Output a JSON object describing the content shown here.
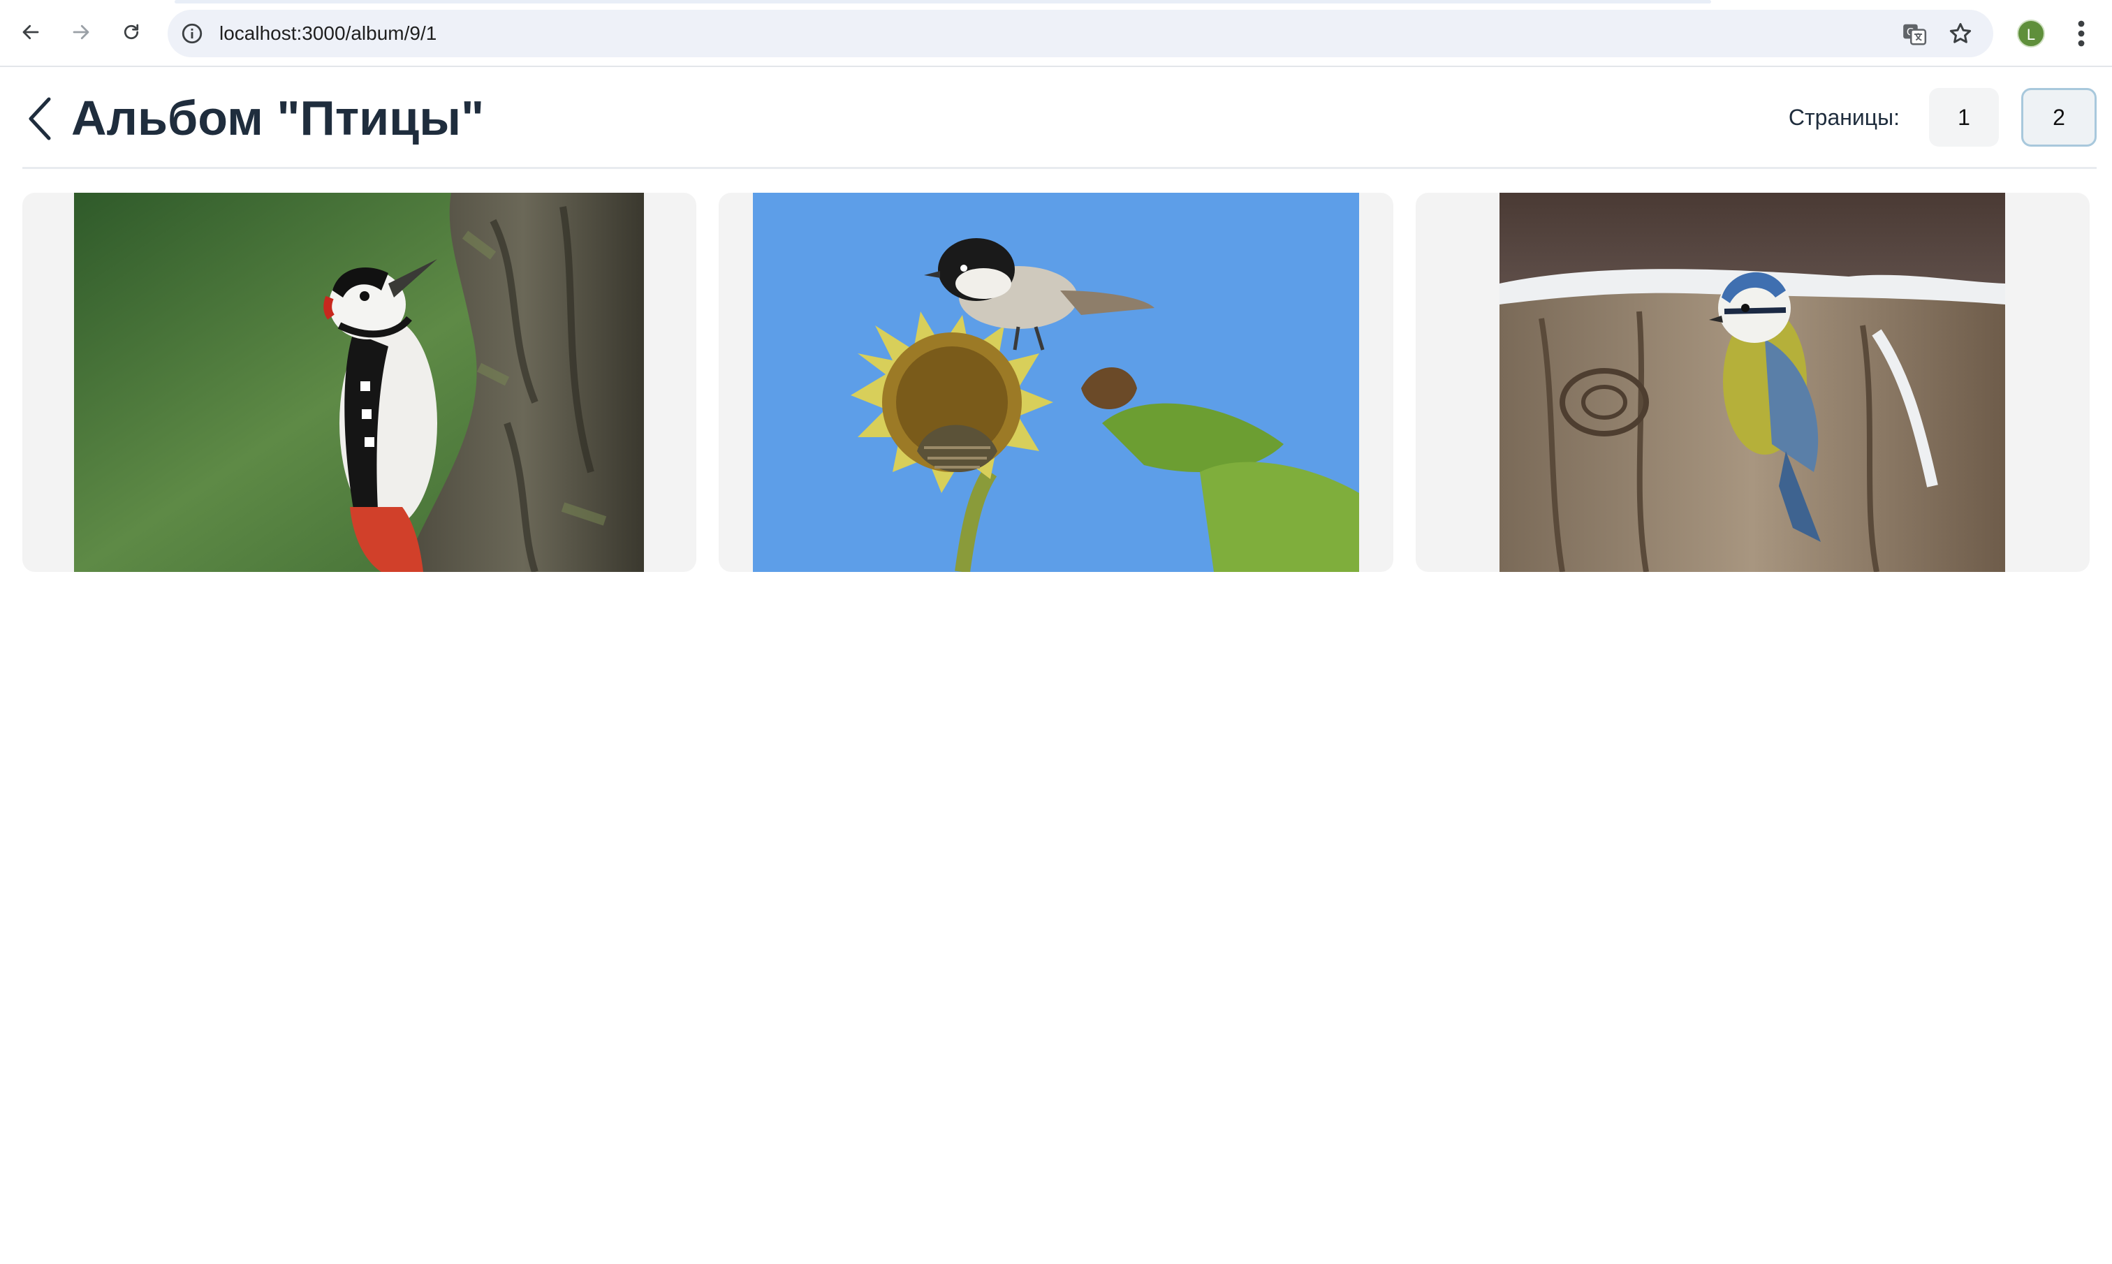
{
  "browser": {
    "url": "localhost:3000/album/9/1",
    "profile_initial": "L"
  },
  "header": {
    "title": "Альбом \"Птицы\"",
    "pages_label": "Страницы:",
    "pages": [
      "1",
      "2"
    ],
    "current_page": "2"
  },
  "gallery": {
    "photos": [
      {
        "subject": "woodpecker-on-tree-trunk"
      },
      {
        "subject": "tit-on-sunflower"
      },
      {
        "subject": "blue-tit-on-snowy-stump"
      }
    ]
  },
  "colors": {
    "title": "#1f2d3d",
    "card_bg": "#f3f3f3",
    "active_page_border": "#a8c8dc",
    "profile": "#5f8f3b"
  }
}
